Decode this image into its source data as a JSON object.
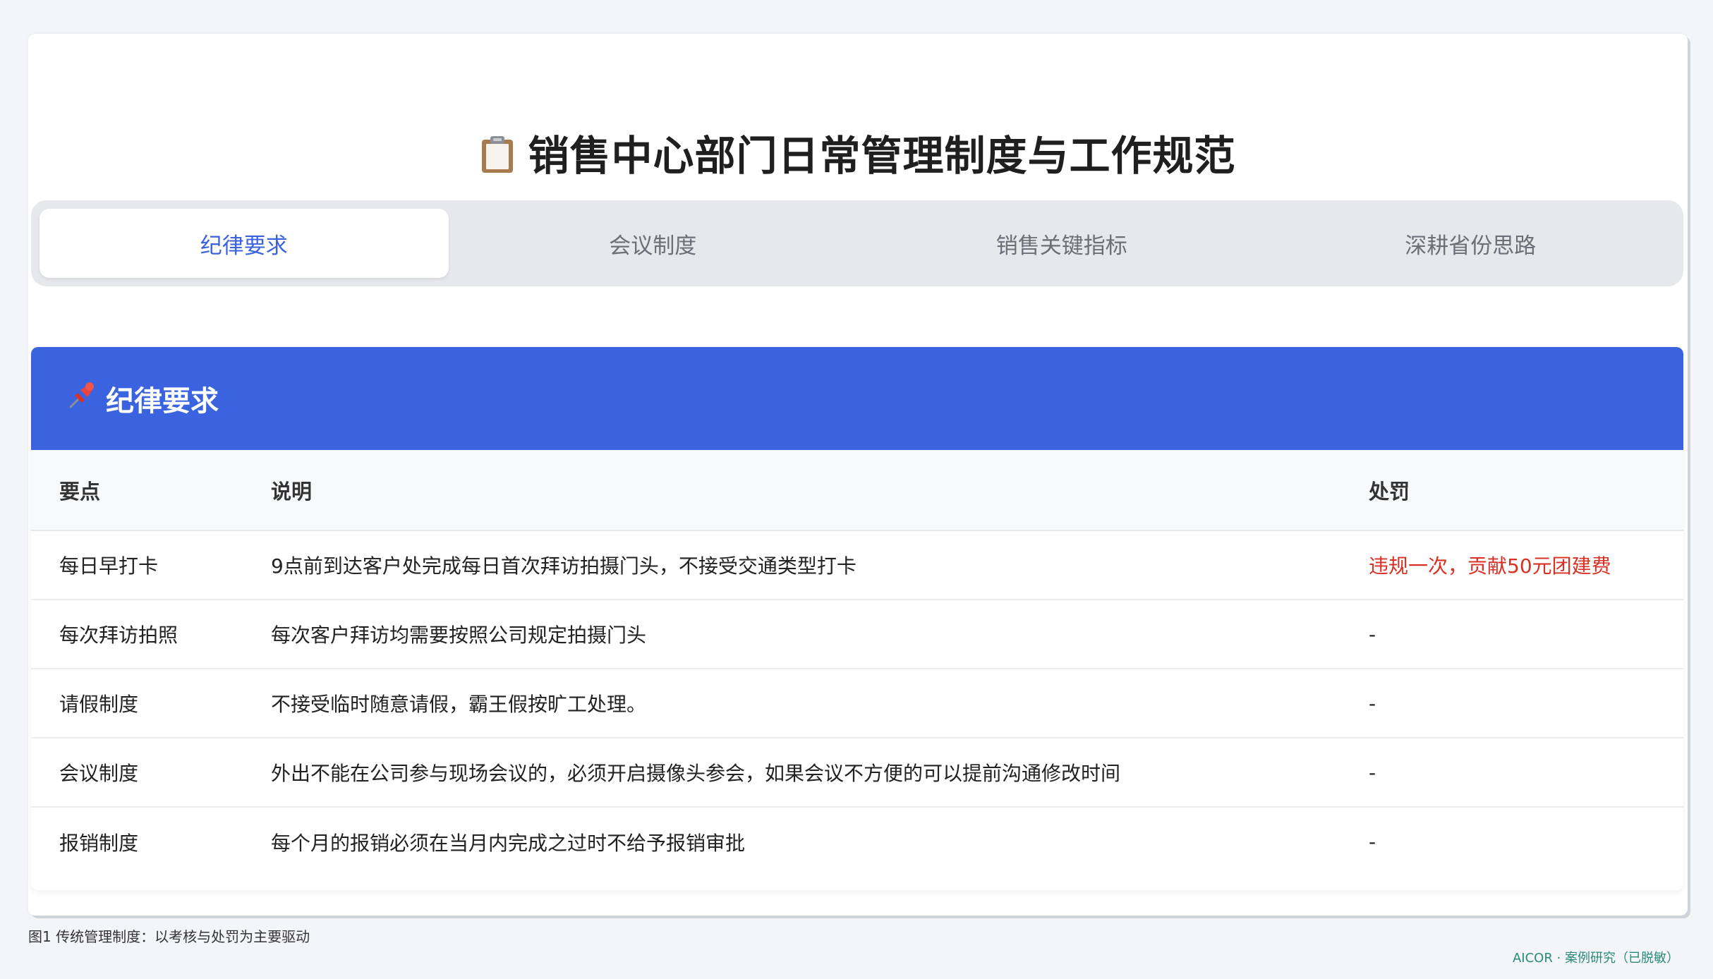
{
  "page": {
    "title": "销售中心部门日常管理制度与工作规范"
  },
  "tabs": [
    {
      "label": "纪律要求",
      "active": true
    },
    {
      "label": "会议制度",
      "active": false
    },
    {
      "label": "销售关键指标",
      "active": false
    },
    {
      "label": "深耕省份思路",
      "active": false
    }
  ],
  "section": {
    "title": "纪律要求",
    "columns": [
      "要点",
      "说明",
      "处罚"
    ],
    "rows": [
      {
        "point": "每日早打卡",
        "desc": "9点前到达客户处完成每日首次拜访拍摄门头，不接受交通类型打卡",
        "penalty": "违规一次，贡献50元团建费"
      },
      {
        "point": "每次拜访拍照",
        "desc": "每次客户拜访均需要按照公司规定拍摄门头",
        "penalty": "-"
      },
      {
        "point": "请假制度",
        "desc": "不接受临时随意请假，霸王假按旷工处理。",
        "penalty": "-"
      },
      {
        "point": "会议制度",
        "desc": "外出不能在公司参与现场会议的，必须开启摄像头参会，如果会议不方便的可以提前沟通修改时间",
        "penalty": "-"
      },
      {
        "point": "报销制度",
        "desc": "每个月的报销必须在当月内完成之过时不给予报销审批",
        "penalty": "-"
      }
    ]
  },
  "caption": "图1 传统管理制度：以考核与处罚为主要驱动",
  "footer": "AICOR · 案例研究（已脱敏）",
  "colors": {
    "accent": "#3b63e0",
    "penalty": "#d93025"
  },
  "icons": {
    "title": "clipboard-icon",
    "section": "pushpin-icon"
  }
}
